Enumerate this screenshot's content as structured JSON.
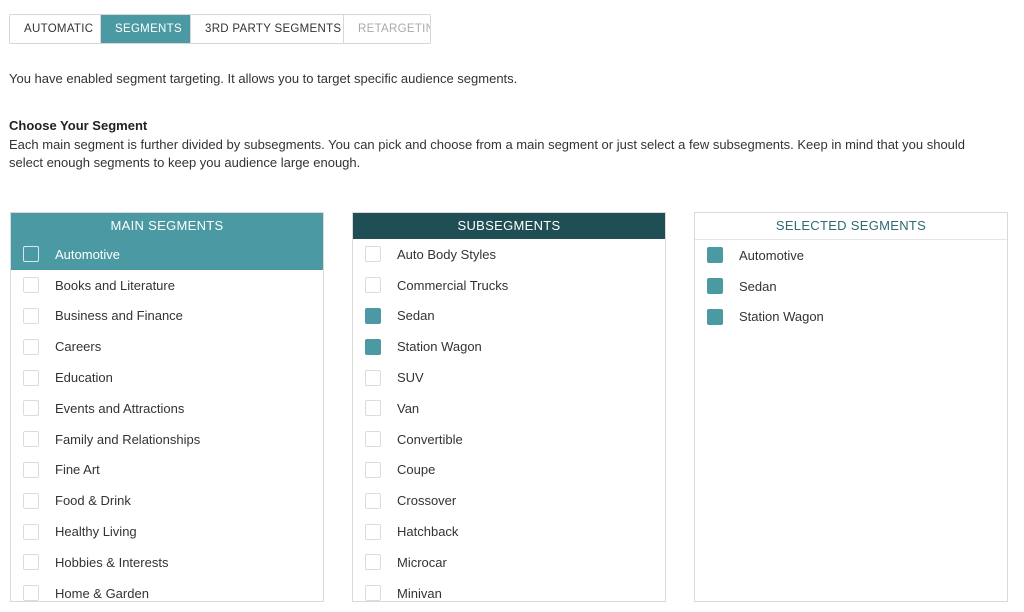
{
  "tabs": [
    {
      "label": "AUTOMATIC",
      "state": "normal"
    },
    {
      "label": "SEGMENTS",
      "state": "active"
    },
    {
      "label": "3RD PARTY SEGMENTS",
      "state": "normal"
    },
    {
      "label": "RETARGETING",
      "state": "disabled"
    }
  ],
  "intro_text": "You have enabled segment targeting. It allows you to target specific audience segments.",
  "choose": {
    "title": "Choose Your Segment",
    "description": "Each main segment is further divided by subsegments. You can pick and choose from a main segment or just select a few subsegments. Keep in mind that you should select enough segments to keep you audience large enough."
  },
  "main_segments": {
    "header": "MAIN SEGMENTS",
    "items": [
      {
        "label": "Automotive",
        "highlighted": true,
        "checked": false
      },
      {
        "label": "Books and Literature",
        "checked": false
      },
      {
        "label": "Business and Finance",
        "checked": false
      },
      {
        "label": "Careers",
        "checked": false
      },
      {
        "label": "Education",
        "checked": false
      },
      {
        "label": "Events and Attractions",
        "checked": false
      },
      {
        "label": "Family and Relationships",
        "checked": false
      },
      {
        "label": "Fine Art",
        "checked": false
      },
      {
        "label": "Food & Drink",
        "checked": false
      },
      {
        "label": "Healthy Living",
        "checked": false
      },
      {
        "label": "Hobbies & Interests",
        "checked": false
      },
      {
        "label": "Home & Garden",
        "checked": false
      }
    ]
  },
  "subsegments": {
    "header": "SUBSEGMENTS",
    "items": [
      {
        "label": "Auto Body Styles",
        "checked": false
      },
      {
        "label": "Commercial Trucks",
        "checked": false
      },
      {
        "label": "Sedan",
        "checked": true
      },
      {
        "label": "Station Wagon",
        "checked": true
      },
      {
        "label": "SUV",
        "checked": false
      },
      {
        "label": "Van",
        "checked": false
      },
      {
        "label": "Convertible",
        "checked": false
      },
      {
        "label": "Coupe",
        "checked": false
      },
      {
        "label": "Crossover",
        "checked": false
      },
      {
        "label": "Hatchback",
        "checked": false
      },
      {
        "label": "Microcar",
        "checked": false
      },
      {
        "label": "Minivan",
        "checked": false
      }
    ]
  },
  "selected_segments": {
    "header": "SELECTED SEGMENTS",
    "items": [
      {
        "label": "Automotive",
        "checked": true
      },
      {
        "label": "Sedan",
        "checked": true
      },
      {
        "label": "Station Wagon",
        "checked": true
      }
    ]
  },
  "colors": {
    "accent": "#4b9aa3",
    "dark_header": "#1f4f55",
    "selected_header_text": "#2d6a72"
  }
}
